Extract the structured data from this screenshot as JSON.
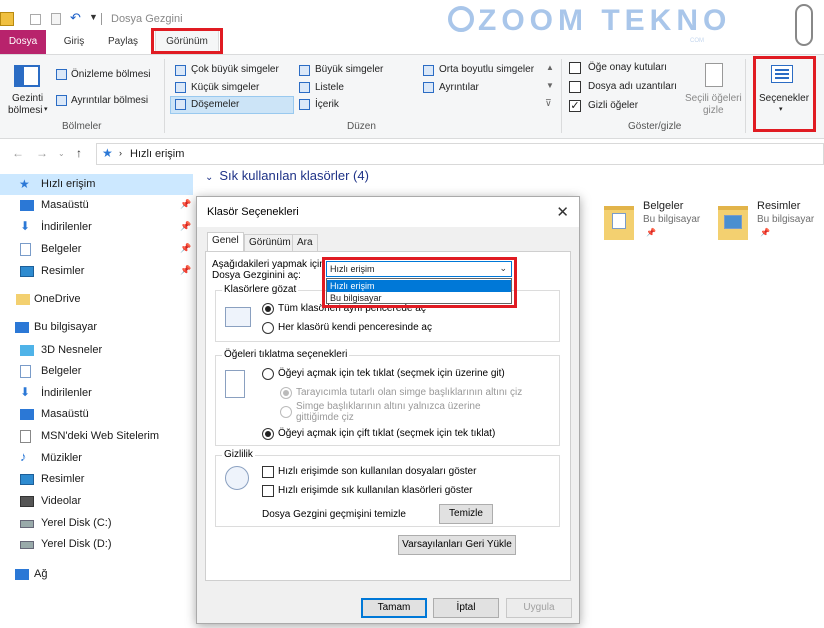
{
  "window": {
    "title": "Dosya Gezgini"
  },
  "watermark": {
    "text": "ZOOM TEKNO",
    "sub": "COM"
  },
  "tabs": {
    "file": "Dosya",
    "home": "Giriş",
    "share": "Paylaş",
    "view": "Görünüm"
  },
  "ribbon": {
    "panes": {
      "nav_pane_line1": "Gezinti",
      "nav_pane_line2": "bölmesi",
      "preview_pane": "Önizleme bölmesi",
      "details_pane": "Ayrıntılar bölmesi",
      "group_label": "Bölmeler"
    },
    "layout": {
      "items": [
        "Çok büyük simgeler",
        "Büyük simgeler",
        "Orta boyutlu simgeler",
        "Küçük simgeler",
        "Listele",
        "Ayrıntılar",
        "Döşemeler",
        "İçerik"
      ],
      "group_label": "Düzen"
    },
    "show_hide": {
      "item_checkboxes": "Öğe onay kutuları",
      "file_extensions": "Dosya adı uzantıları",
      "hidden_items": "Gizli öğeler",
      "hide_selected_line1": "Seçili öğeleri",
      "hide_selected_line2": "gizle",
      "options": "Seçenekler",
      "group_label": "Göster/gizle",
      "hidden_items_checked": true
    }
  },
  "address": {
    "path": "Hızlı erişim"
  },
  "nav": {
    "items": [
      {
        "label": "Hızlı erişim",
        "icon": "star-icon",
        "pinned": false,
        "selected": true
      },
      {
        "label": "Masaüstü",
        "icon": "desktop-icon",
        "pinned": true
      },
      {
        "label": "İndirilenler",
        "icon": "download-icon",
        "pinned": true
      },
      {
        "label": "Belgeler",
        "icon": "documents-icon",
        "pinned": true
      },
      {
        "label": "Resimler",
        "icon": "pictures-icon",
        "pinned": true
      },
      {
        "label": "OneDrive",
        "icon": "onedrive-icon"
      },
      {
        "label": "Bu bilgisayar",
        "icon": "computer-icon"
      },
      {
        "label": "3D Nesneler",
        "icon": "3d-objects-icon"
      },
      {
        "label": "Belgeler",
        "icon": "documents-icon"
      },
      {
        "label": "İndirilenler",
        "icon": "download-icon"
      },
      {
        "label": "Masaüstü",
        "icon": "desktop-icon"
      },
      {
        "label": "MSN'deki Web Sitelerim",
        "icon": "web-icon"
      },
      {
        "label": "Müzikler",
        "icon": "music-icon"
      },
      {
        "label": "Resimler",
        "icon": "pictures-icon"
      },
      {
        "label": "Videolar",
        "icon": "videos-icon"
      },
      {
        "label": "Yerel Disk (C:)",
        "icon": "disk-icon"
      },
      {
        "label": "Yerel Disk (D:)",
        "icon": "disk-icon"
      },
      {
        "label": "Ağ",
        "icon": "network-icon"
      }
    ]
  },
  "content": {
    "section_header": "Sık kullanılan klasörler (4)",
    "folders": [
      {
        "name": "Belgeler",
        "location": "Bu bilgisayar"
      },
      {
        "name": "Resimler",
        "location": "Bu bilgisayar"
      }
    ]
  },
  "dialog": {
    "title": "Klasör Seçenekleri",
    "tabs": [
      "Genel",
      "Görünüm",
      "Ara"
    ],
    "open_with_line1": "Aşağıdakileri yapmak için",
    "open_with_line2": "Dosya Gezginini aç:",
    "open_with_value": "Hızlı erişim",
    "dropdown_options": [
      "Hızlı erişim",
      "Bu bilgisayar"
    ],
    "browse_legend": "Klasörlere gözat",
    "browse_same": "Tüm klasörleri aynı pencerede aç",
    "browse_new": "Her klasörü kendi penceresinde aç",
    "click_legend": "Öğeleri tıklatma seçenekleri",
    "single_click": "Öğeyi açmak için tek tıklat (seçmek için üzerine git)",
    "underline_browser": "Tarayıcımla tutarlı olan simge başlıklarının altını çiz",
    "underline_hover_line1": "Simge başlıklarının altını yalnızca üzerine",
    "underline_hover_line2": "gittiğimde çiz",
    "double_click": "Öğeyi açmak için çift tıklat (seçmek için tek tıklat)",
    "privacy_legend": "Gizlilik",
    "recent_files": "Hızlı erişimde son kullanılan dosyaları göster",
    "frequent_folders": "Hızlı erişimde sık kullanılan klasörleri göster",
    "clear_history_label": "Dosya Gezgini geçmişini temizle",
    "clear_button": "Temizle",
    "restore_defaults": "Varsayılanları Geri Yükle",
    "ok": "Tamam",
    "cancel": "İptal",
    "apply": "Uygula"
  },
  "colors": {
    "accent": "#b8236c",
    "highlight": "#e01b22",
    "selection": "#0078d7"
  }
}
